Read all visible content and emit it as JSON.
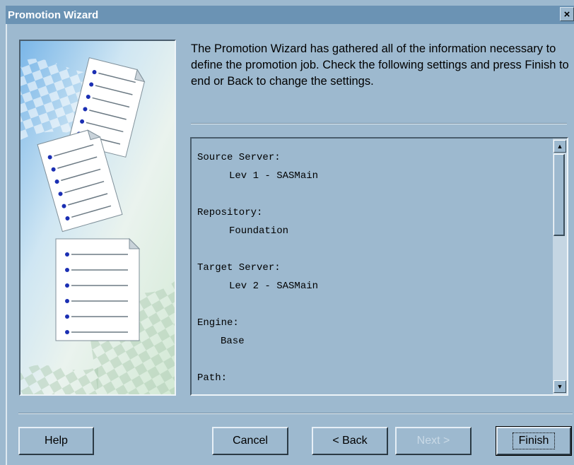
{
  "window": {
    "title": "Promotion Wizard",
    "close_label": "×"
  },
  "intro_text": "The Promotion Wizard has gathered all of the information necessary to define the promotion job. Check the following settings and press Finish to end or Back to change the settings.",
  "summary": {
    "source_server": {
      "label": "Source Server:",
      "value": "Lev 1 - SASMain"
    },
    "repository": {
      "label": "Repository:",
      "value": "Foundation"
    },
    "target_server": {
      "label": "Target Server:",
      "value": "Lev 2 - SASMain"
    },
    "engine": {
      "label": "Engine:",
      "value": "Base"
    },
    "path": {
      "label": "Path:"
    }
  },
  "scrollbar": {
    "up_label": "▲",
    "down_label": "▼"
  },
  "buttons": {
    "help": "Help",
    "cancel": "Cancel",
    "back": "< Back",
    "next": "Next >",
    "finish": "Finish"
  }
}
